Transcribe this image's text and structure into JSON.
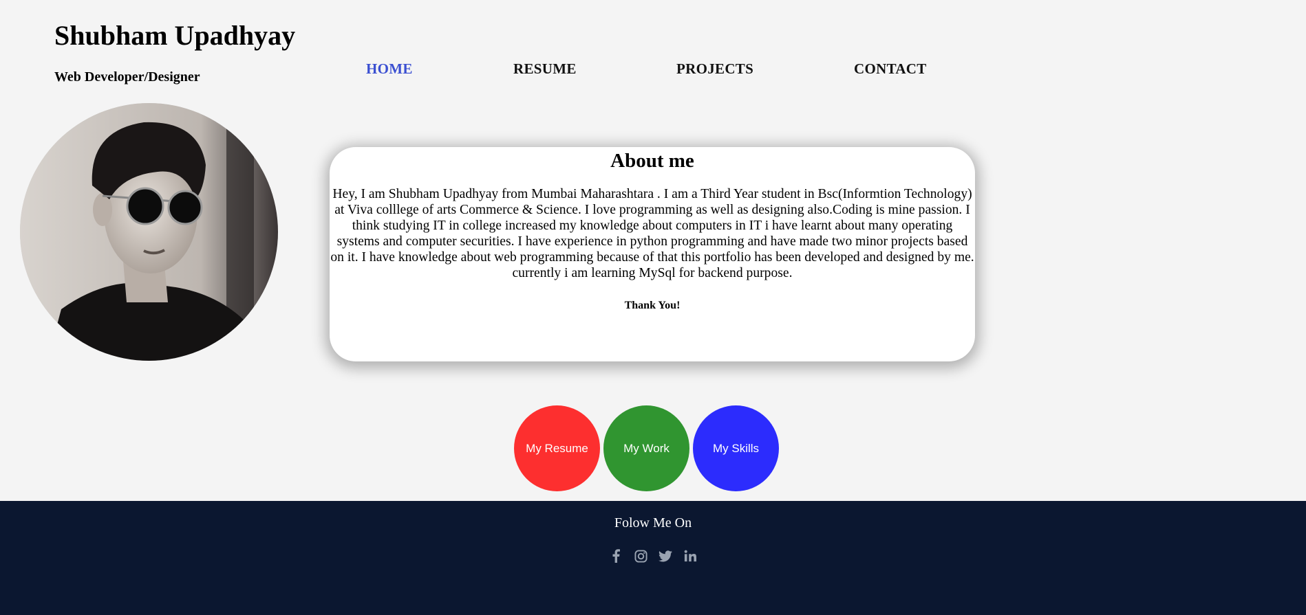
{
  "header": {
    "name": "Shubham Upadhyay",
    "role": "Web Developer/Designer"
  },
  "nav": {
    "items": [
      "HOME",
      "RESUME",
      "PROJECTS",
      "CONTACT"
    ],
    "active": "HOME",
    "active_color": "#3a4fd1"
  },
  "avatar": {
    "alt": "profile photo"
  },
  "about": {
    "title": "About me",
    "body": "Hey, I am Shubham Upadhyay from Mumbai Maharashtara . I am a Third Year student in Bsc(Informtion Technology) at Viva colllege of arts Commerce & Science. I love programming as well as designing also.Coding is mine passion. I think studying IT in college increased my knowledge about computers in IT i have learnt about many operating systems and computer securities. I have experience in python programming and have made two minor projects based on it. I have knowledge about web programming because of that this portfolio has been developed and designed by me. currently i am learning MySql for backend purpose.",
    "thanks": "Thank You!"
  },
  "buttons": [
    {
      "label": "My Resume",
      "color": "#fd2f2f"
    },
    {
      "label": "My Work",
      "color": "#309530"
    },
    {
      "label": "My Skills",
      "color": "#2c2cfd"
    }
  ],
  "footer": {
    "follow": "Folow Me On",
    "background": "#0b1730",
    "socials": [
      "facebook-icon",
      "instagram-icon",
      "twitter-icon",
      "linkedin-icon"
    ]
  }
}
